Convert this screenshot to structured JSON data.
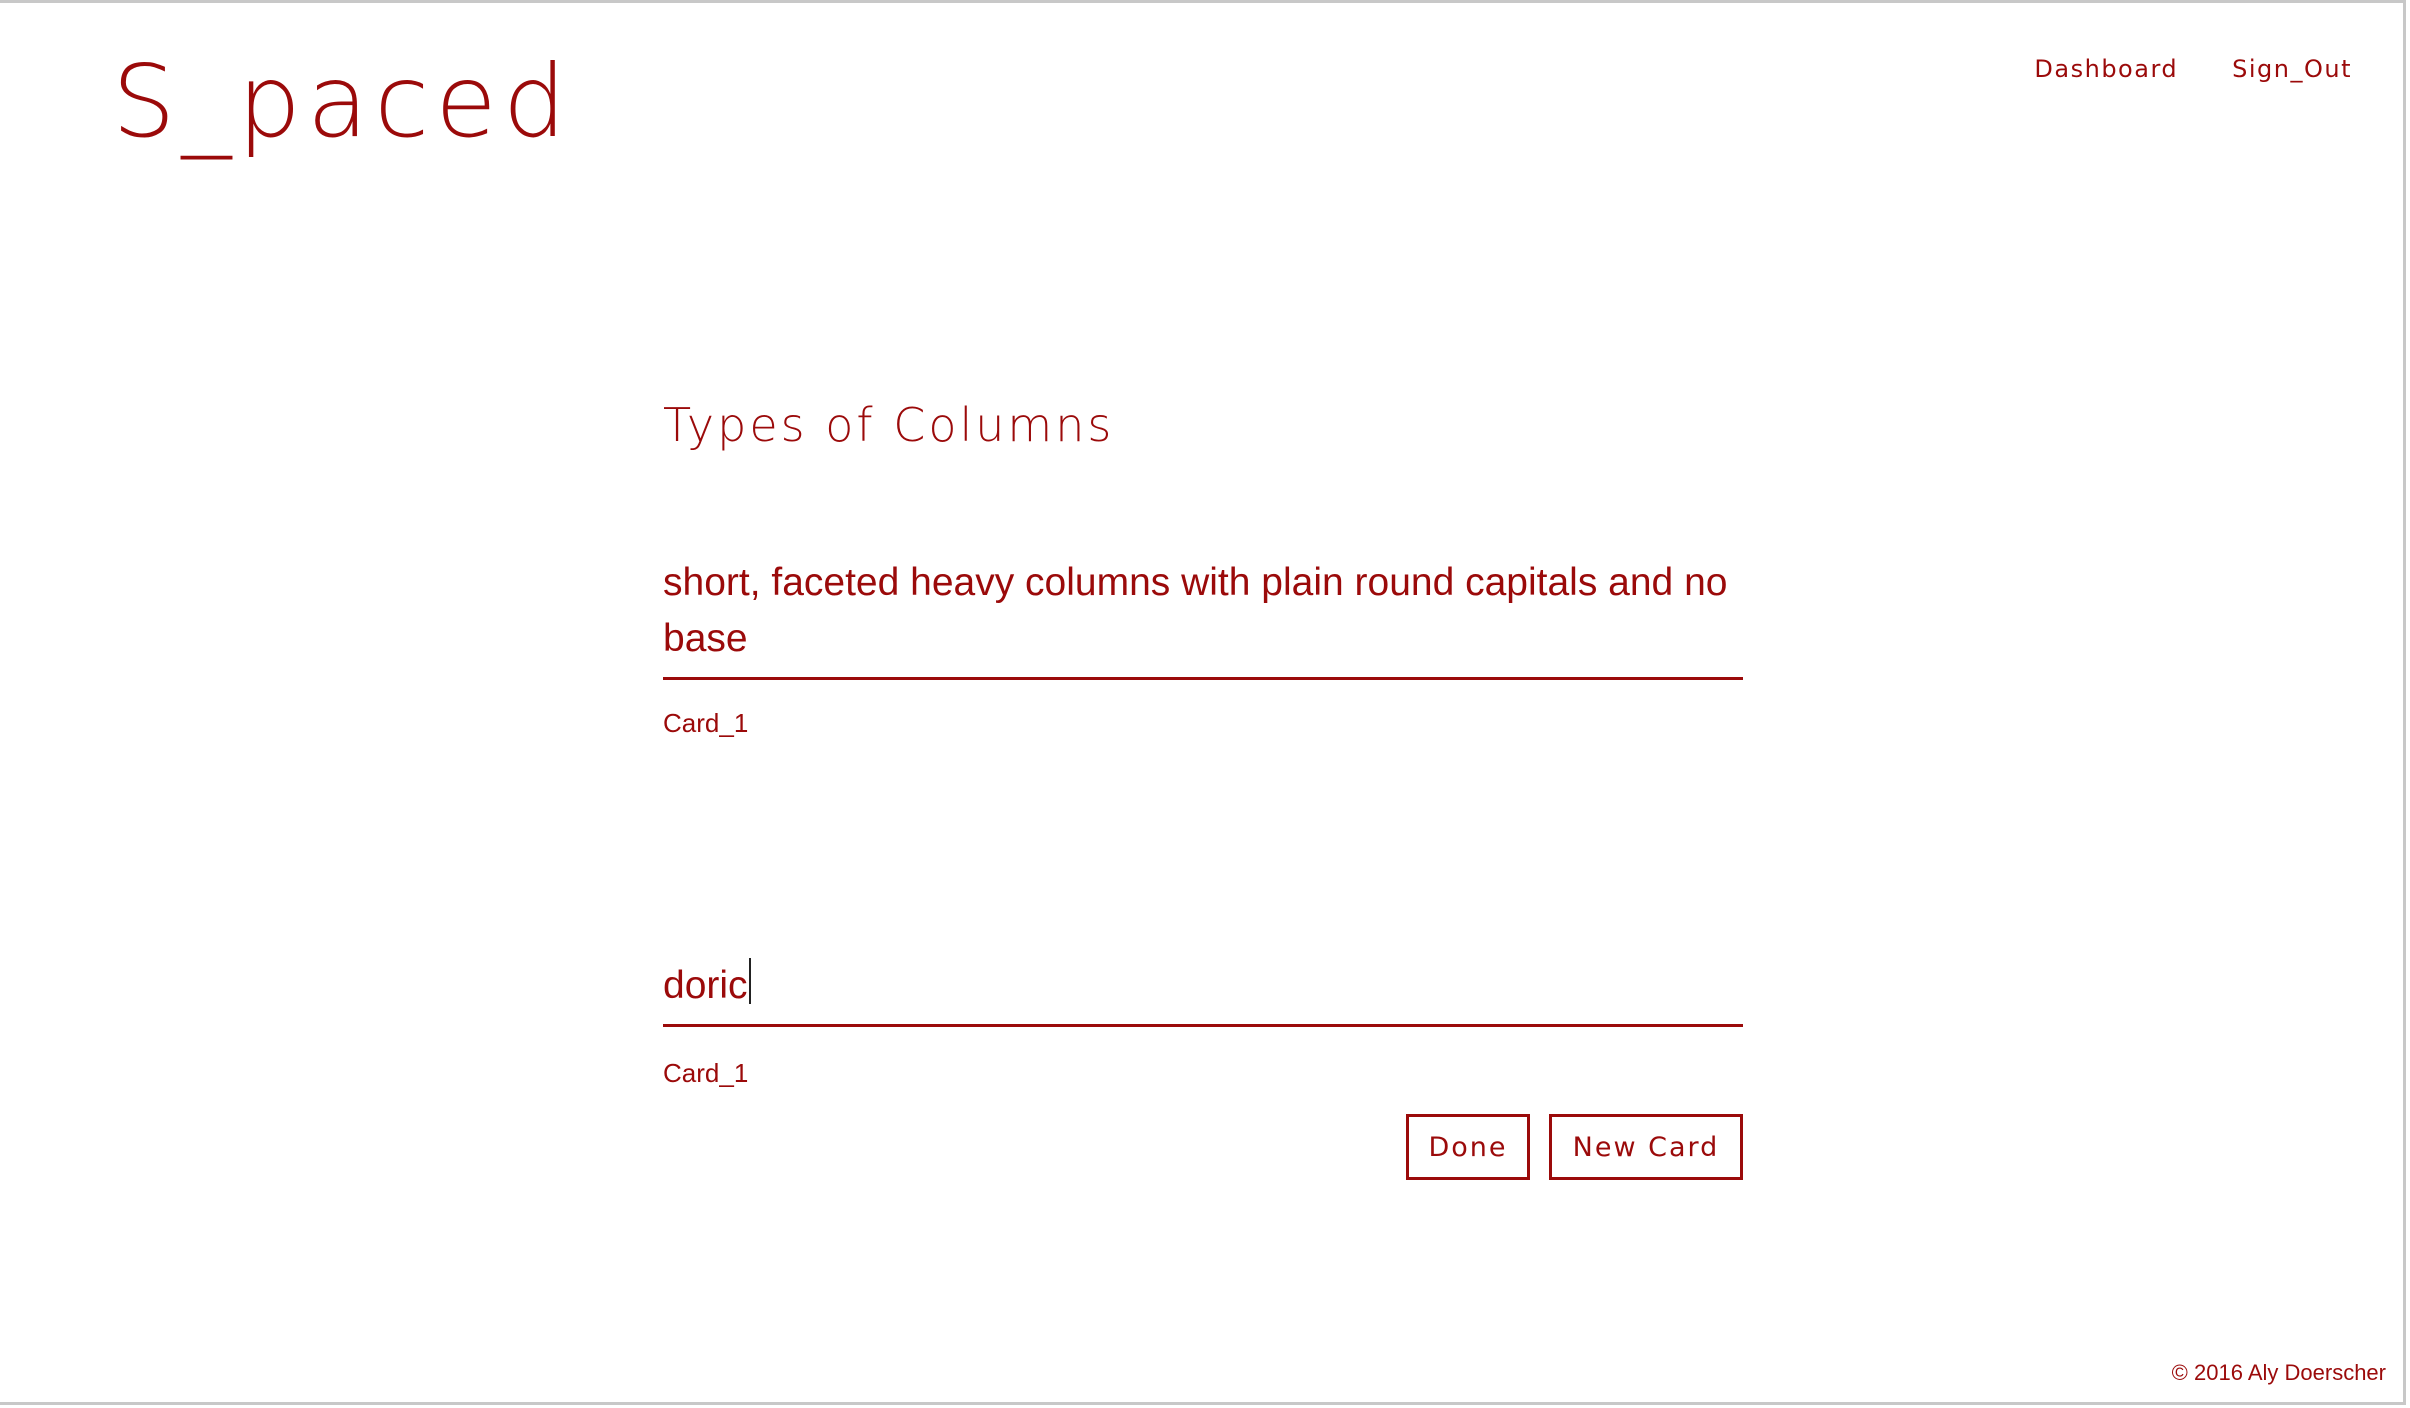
{
  "app": {
    "logo": "S_paced"
  },
  "nav": {
    "dashboard": "Dashboard",
    "sign_out": "Sign_Out"
  },
  "deck": {
    "title": "Types of Columns"
  },
  "cards": [
    {
      "value": "short, faceted heavy columns with plain round capitals and no base",
      "label": "Card_1"
    },
    {
      "value": "doric",
      "label": "Card_1"
    }
  ],
  "buttons": {
    "done": "Done",
    "new_card": "New Card"
  },
  "footer": {
    "copyright": "© 2016 Aly Doerscher"
  },
  "colors": {
    "accent": "#9b0a0a",
    "background": "#ffffff"
  }
}
